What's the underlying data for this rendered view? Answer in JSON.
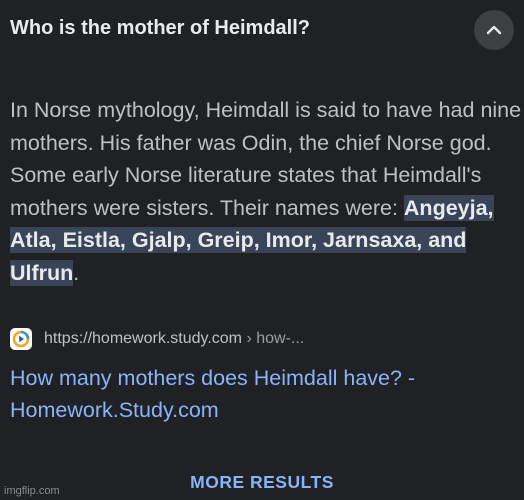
{
  "question": {
    "title": "Who is the mother of Heimdall?",
    "collapse_icon": "chevron-up-icon"
  },
  "answer": {
    "text_before": "In Norse mythology, Heimdall is said to have had nine mothers. His father was Odin, the chief Norse god. Some early Norse literature states that Heimdall's mothers were sisters. Their names were: ",
    "highlight": "Angeyja, Atla, Eistla, Gjalp, Greip, Imor, Jarnsaxa, and Ulfrun",
    "text_after": "."
  },
  "source": {
    "favicon_icon": "study-com-play-icon",
    "url": "https://homework.study.com",
    "path": " › how-..."
  },
  "result": {
    "title": "How many mothers does Heimdall have? - Homework.Study.com"
  },
  "more_results_label": "MORE RESULTS",
  "watermark": "imgflip.com",
  "colors": {
    "background": "#202124",
    "title_text": "#e8eaed",
    "body_text": "#bdc1c6",
    "highlight_bg": "#394457",
    "link": "#8ab4f8"
  }
}
